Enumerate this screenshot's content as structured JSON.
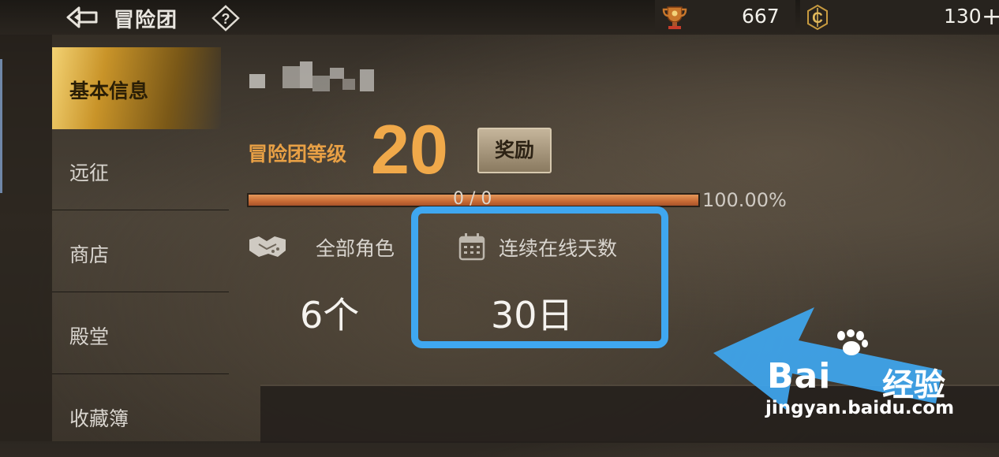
{
  "header": {
    "title": "冒险团",
    "back_icon": "back-arrow-icon",
    "help_icon": "help-diamond-icon",
    "resources": [
      {
        "icon": "trophy-icon",
        "value": "667"
      },
      {
        "icon": "coin-icon",
        "value": "130"
      }
    ],
    "add_symbol": "+"
  },
  "sidebar": {
    "items": [
      {
        "label": "基本信息",
        "active": true
      },
      {
        "label": "远征",
        "active": false
      },
      {
        "label": "商店",
        "active": false
      },
      {
        "label": "殿堂",
        "active": false
      },
      {
        "label": "收藏簿",
        "active": false
      }
    ]
  },
  "main": {
    "level_label": "冒险团等级",
    "level_value": "20",
    "reward_button": "奖励",
    "progress": {
      "text": "0 / 0",
      "percent_label": "100.00%",
      "fill_fraction": 1.0
    },
    "stats": [
      {
        "icon": "handshake-icon",
        "label": "全部角色",
        "value": "6个"
      },
      {
        "icon": "calendar-icon",
        "label": "连续在线天数",
        "value": "30日"
      }
    ]
  },
  "watermark": {
    "brand": "Bai",
    "brand_tail": "经验",
    "url": "jingyan.baidu.com",
    "highlight_color": "#3fa7f0"
  }
}
